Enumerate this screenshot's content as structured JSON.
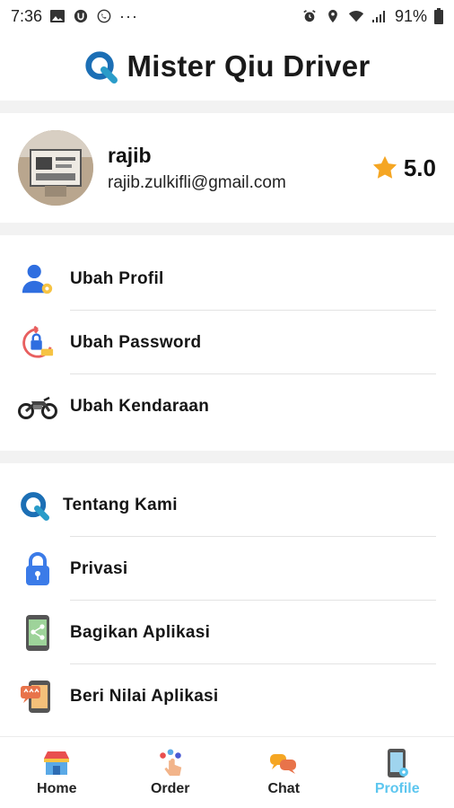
{
  "status_bar": {
    "time": "7:36",
    "battery": "91%"
  },
  "app": {
    "title": "Mister Qiu Driver"
  },
  "profile": {
    "name": "rajib",
    "email": "rajib.zulkifli@gmail.com",
    "rating": "5.0"
  },
  "account_menu": [
    {
      "label": "Ubah Profil",
      "icon": "user-gear-icon"
    },
    {
      "label": "Ubah Password",
      "icon": "password-reset-icon"
    },
    {
      "label": "Ubah Kendaraan",
      "icon": "motorcycle-icon"
    }
  ],
  "info_menu": [
    {
      "label": "Tentang Kami",
      "icon": "q-logo-icon"
    },
    {
      "label": "Privasi",
      "icon": "lock-icon"
    },
    {
      "label": "Bagikan Aplikasi",
      "icon": "share-phone-icon"
    },
    {
      "label": "Beri Nilai Aplikasi",
      "icon": "rate-phone-icon"
    }
  ],
  "bottom_nav": {
    "items": [
      {
        "label": "Home",
        "icon": "store-icon"
      },
      {
        "label": "Order",
        "icon": "tap-icon"
      },
      {
        "label": "Chat",
        "icon": "chat-bubbles-icon"
      },
      {
        "label": "Profile",
        "icon": "phone-profile-icon"
      }
    ],
    "active": "Profile"
  },
  "colors": {
    "brand_blue": "#1c6fb5",
    "brand_teal": "#2a9cc9",
    "active_nav": "#5cc6ef",
    "star": "#f5a623",
    "separator": "#f2f2f2"
  }
}
